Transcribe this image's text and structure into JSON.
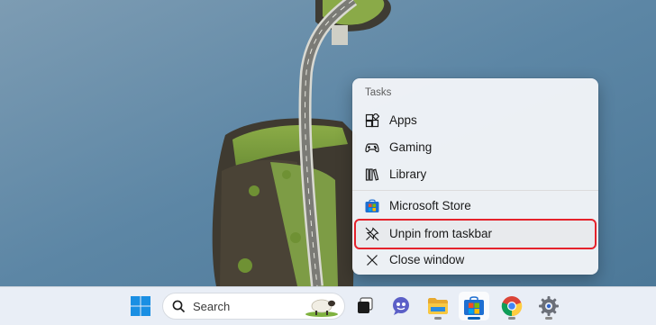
{
  "wallpaper": {
    "description_icon": "landscape-wallpaper"
  },
  "jumplist": {
    "header": "Tasks",
    "items": [
      {
        "label": "Apps",
        "icon": "apps-grid-icon"
      },
      {
        "label": "Gaming",
        "icon": "gamepad-icon"
      },
      {
        "label": "Library",
        "icon": "library-icon"
      }
    ],
    "actions": [
      {
        "label": "Microsoft Store",
        "icon": "microsoft-store-icon"
      },
      {
        "label": "Unpin from taskbar",
        "icon": "unpin-icon",
        "highlighted": true
      },
      {
        "label": "Close window",
        "icon": "close-icon"
      }
    ],
    "highlight_color": "#e5222b"
  },
  "taskbar": {
    "search_placeholder": "Search",
    "apps": [
      {
        "name": "Start",
        "icon": "windows-start-icon"
      },
      {
        "name": "Task View",
        "icon": "task-view-icon"
      },
      {
        "name": "Copilot",
        "icon": "chat-icon"
      },
      {
        "name": "File Explorer",
        "icon": "folder-icon",
        "running": true
      },
      {
        "name": "Microsoft Store",
        "icon": "microsoft-store-icon",
        "running": true,
        "active": true
      },
      {
        "name": "Chrome",
        "icon": "chrome-icon",
        "running": true
      },
      {
        "name": "Settings",
        "icon": "settings-gear-icon",
        "running": true
      }
    ],
    "accent": "#005fb8"
  }
}
